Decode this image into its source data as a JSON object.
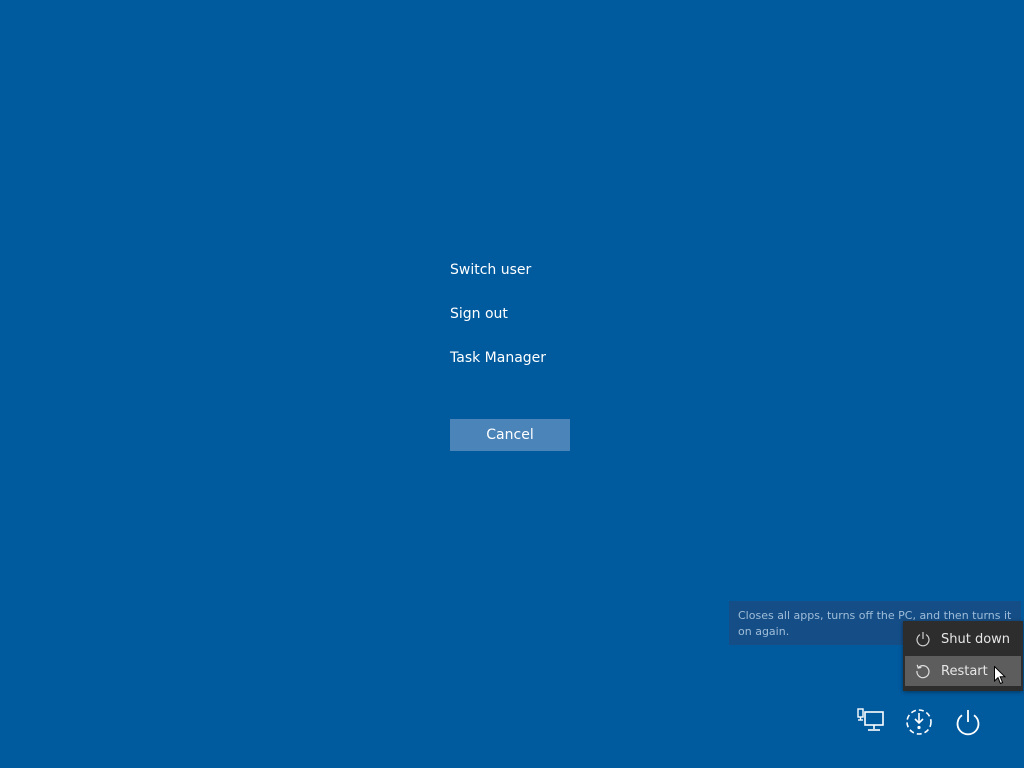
{
  "menu": {
    "items": [
      {
        "label": "Switch user"
      },
      {
        "label": "Sign out"
      },
      {
        "label": "Task Manager"
      }
    ]
  },
  "cancel_button": {
    "label": "Cancel"
  },
  "tooltip": {
    "text": "Closes all apps, turns off the PC, and then turns it on again."
  },
  "power_menu": {
    "options": [
      {
        "label": "Shut down",
        "icon": "power-icon",
        "hovered": false
      },
      {
        "label": "Restart",
        "icon": "restart-icon",
        "hovered": true
      }
    ]
  },
  "tray": {
    "icons": [
      "network-icon",
      "ease-of-access-icon",
      "power-icon"
    ]
  },
  "colors": {
    "background": "#005a9e",
    "button": "#4a84b9",
    "menu_bg": "#2d2d2d",
    "menu_hover": "#5d5d5d",
    "tooltip_bg": "#154e86"
  }
}
